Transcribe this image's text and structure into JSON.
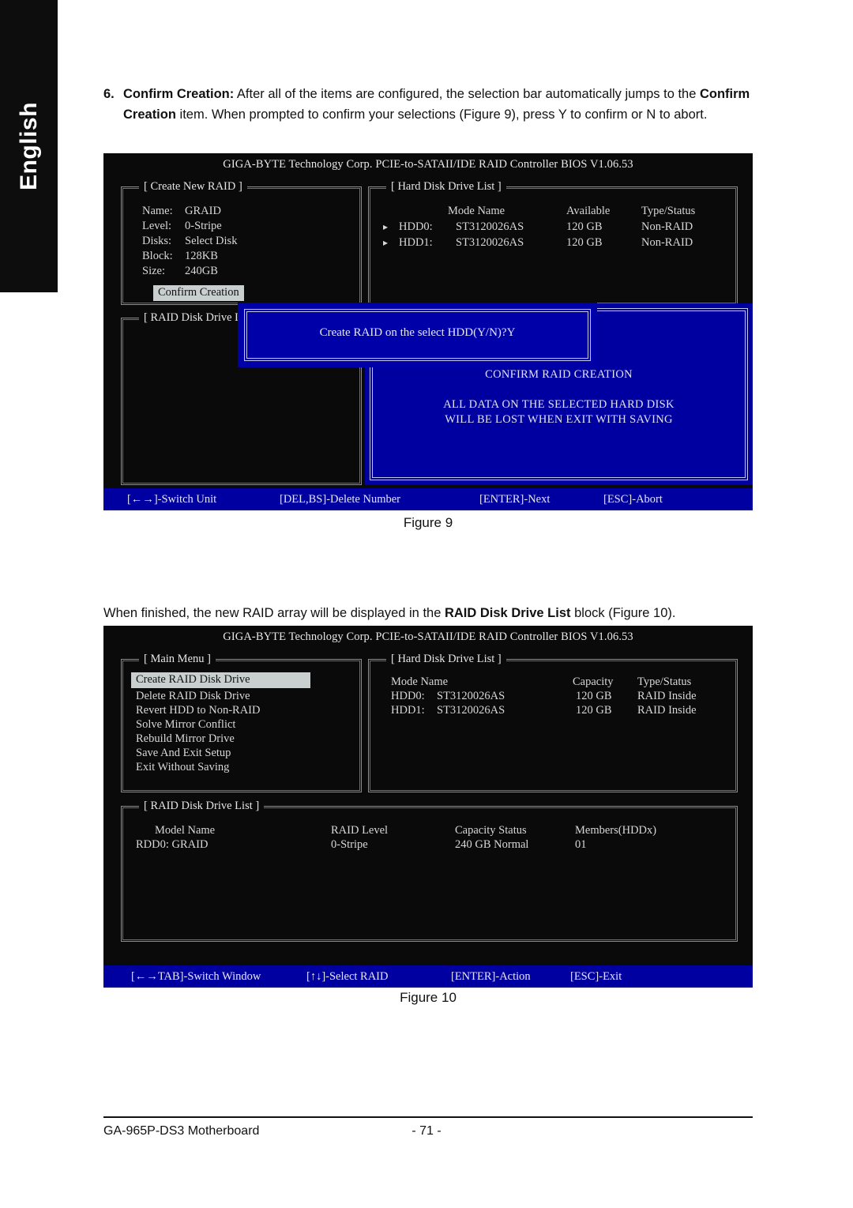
{
  "sidebar": {
    "language_tab": "English"
  },
  "step6": {
    "number": "6.",
    "term": "Confirm Creation:",
    "text_part1": " After all of the items are configured, the selection bar automatically jumps to the ",
    "term2": "Confirm Creation",
    "text_part2": " item. When prompted to confirm your selections (Figure 9), press Y to confirm or N to abort."
  },
  "figure9": {
    "caption": "Figure 9",
    "bios_title": "GIGA-BYTE Technology Corp. PCIE-to-SATAII/IDE RAID Controller BIOS V1.06.53",
    "create_new_raid": {
      "label": "[ Create New RAID ]",
      "fields": [
        {
          "key": "Name:",
          "value": "GRAID"
        },
        {
          "key": "Level:",
          "value": "0-Stripe"
        },
        {
          "key": "Disks:",
          "value": "Select Disk"
        },
        {
          "key": "Block:",
          "value": "128KB"
        },
        {
          "key": "Size:",
          "value": "240GB"
        }
      ],
      "confirm_button": "Confirm Creation"
    },
    "hard_disk_drive_list": {
      "label": "[ Hard Disk Drive List ]",
      "columns": [
        "Mode Name",
        "Available",
        "Type/Status"
      ],
      "rows": [
        {
          "marker": "▸",
          "id": "HDD0:",
          "model": "ST3120026AS",
          "available": "120 GB",
          "status": "Non-RAID"
        },
        {
          "marker": "▸",
          "id": "HDD1:",
          "model": "ST3120026AS",
          "available": "120 GB",
          "status": "Non-RAID"
        }
      ]
    },
    "raid_disk_drive_list": {
      "label": "[ RAID Disk Drive List ]"
    },
    "modal": {
      "prompt": "Create RAID on the select HDD(Y/N)?Y"
    },
    "confirm_panel": {
      "heading": "CONFIRM RAID CREATION",
      "line1": "ALL DATA ON THE SELECTED HARD DISK",
      "line2": "WILL BE LOST WHEN EXIT WITH SAVING"
    },
    "statusbar": [
      "[←→]-Switch Unit",
      "[DEL,BS]-Delete Number",
      "[ENTER]-Next",
      "[ESC]-Abort"
    ]
  },
  "para_finished": {
    "text_part1": "When finished, the new RAID array will be displayed in the ",
    "bold": "RAID Disk Drive List",
    "text_part2": " block (Figure 10)."
  },
  "figure10": {
    "caption": "Figure 10",
    "bios_title": "GIGA-BYTE Technology Corp. PCIE-to-SATAII/IDE RAID Controller BIOS V1.06.53",
    "main_menu": {
      "label": "[ Main Menu ]",
      "items": [
        "Create RAID Disk Drive",
        "Delete RAID Disk Drive",
        "Revert HDD to Non-RAID",
        "Solve Mirror Conflict",
        "Rebuild Mirror Drive",
        "Save And Exit Setup",
        "Exit Without Saving"
      ],
      "selected_index": 0
    },
    "hard_disk_drive_list": {
      "label": "[ Hard Disk Drive List ]",
      "columns": [
        "Mode Name",
        "Capacity",
        "Type/Status"
      ],
      "rows": [
        {
          "id": "HDD0:",
          "model": "ST3120026AS",
          "capacity": "120 GB",
          "status": "RAID Inside"
        },
        {
          "id": "HDD1:",
          "model": "ST3120026AS",
          "capacity": "120 GB",
          "status": "RAID Inside"
        }
      ]
    },
    "raid_disk_drive_list": {
      "label": "[ RAID Disk Drive List ]",
      "columns": [
        "Model Name",
        "RAID Level",
        "Capacity Status",
        "Members(HDDx)"
      ],
      "rows": [
        {
          "model": "RDD0: GRAID",
          "level": "0-Stripe",
          "capacity_status": "240 GB Normal",
          "members": "01"
        }
      ]
    },
    "statusbar": [
      "[←→TAB]-Switch Window",
      "[↑↓]-Select RAID",
      "[ENTER]-Action",
      "[ESC]-Exit"
    ]
  },
  "footer": {
    "product": "GA-965P-DS3 Motherboard",
    "page": "- 71 -"
  },
  "colors": {
    "bios_background": "#0a0a0a",
    "bios_text": "#d8d8d8",
    "blue": "#0000a0",
    "modal_blue": "#0000a8",
    "highlight": "#c9cfcf"
  }
}
